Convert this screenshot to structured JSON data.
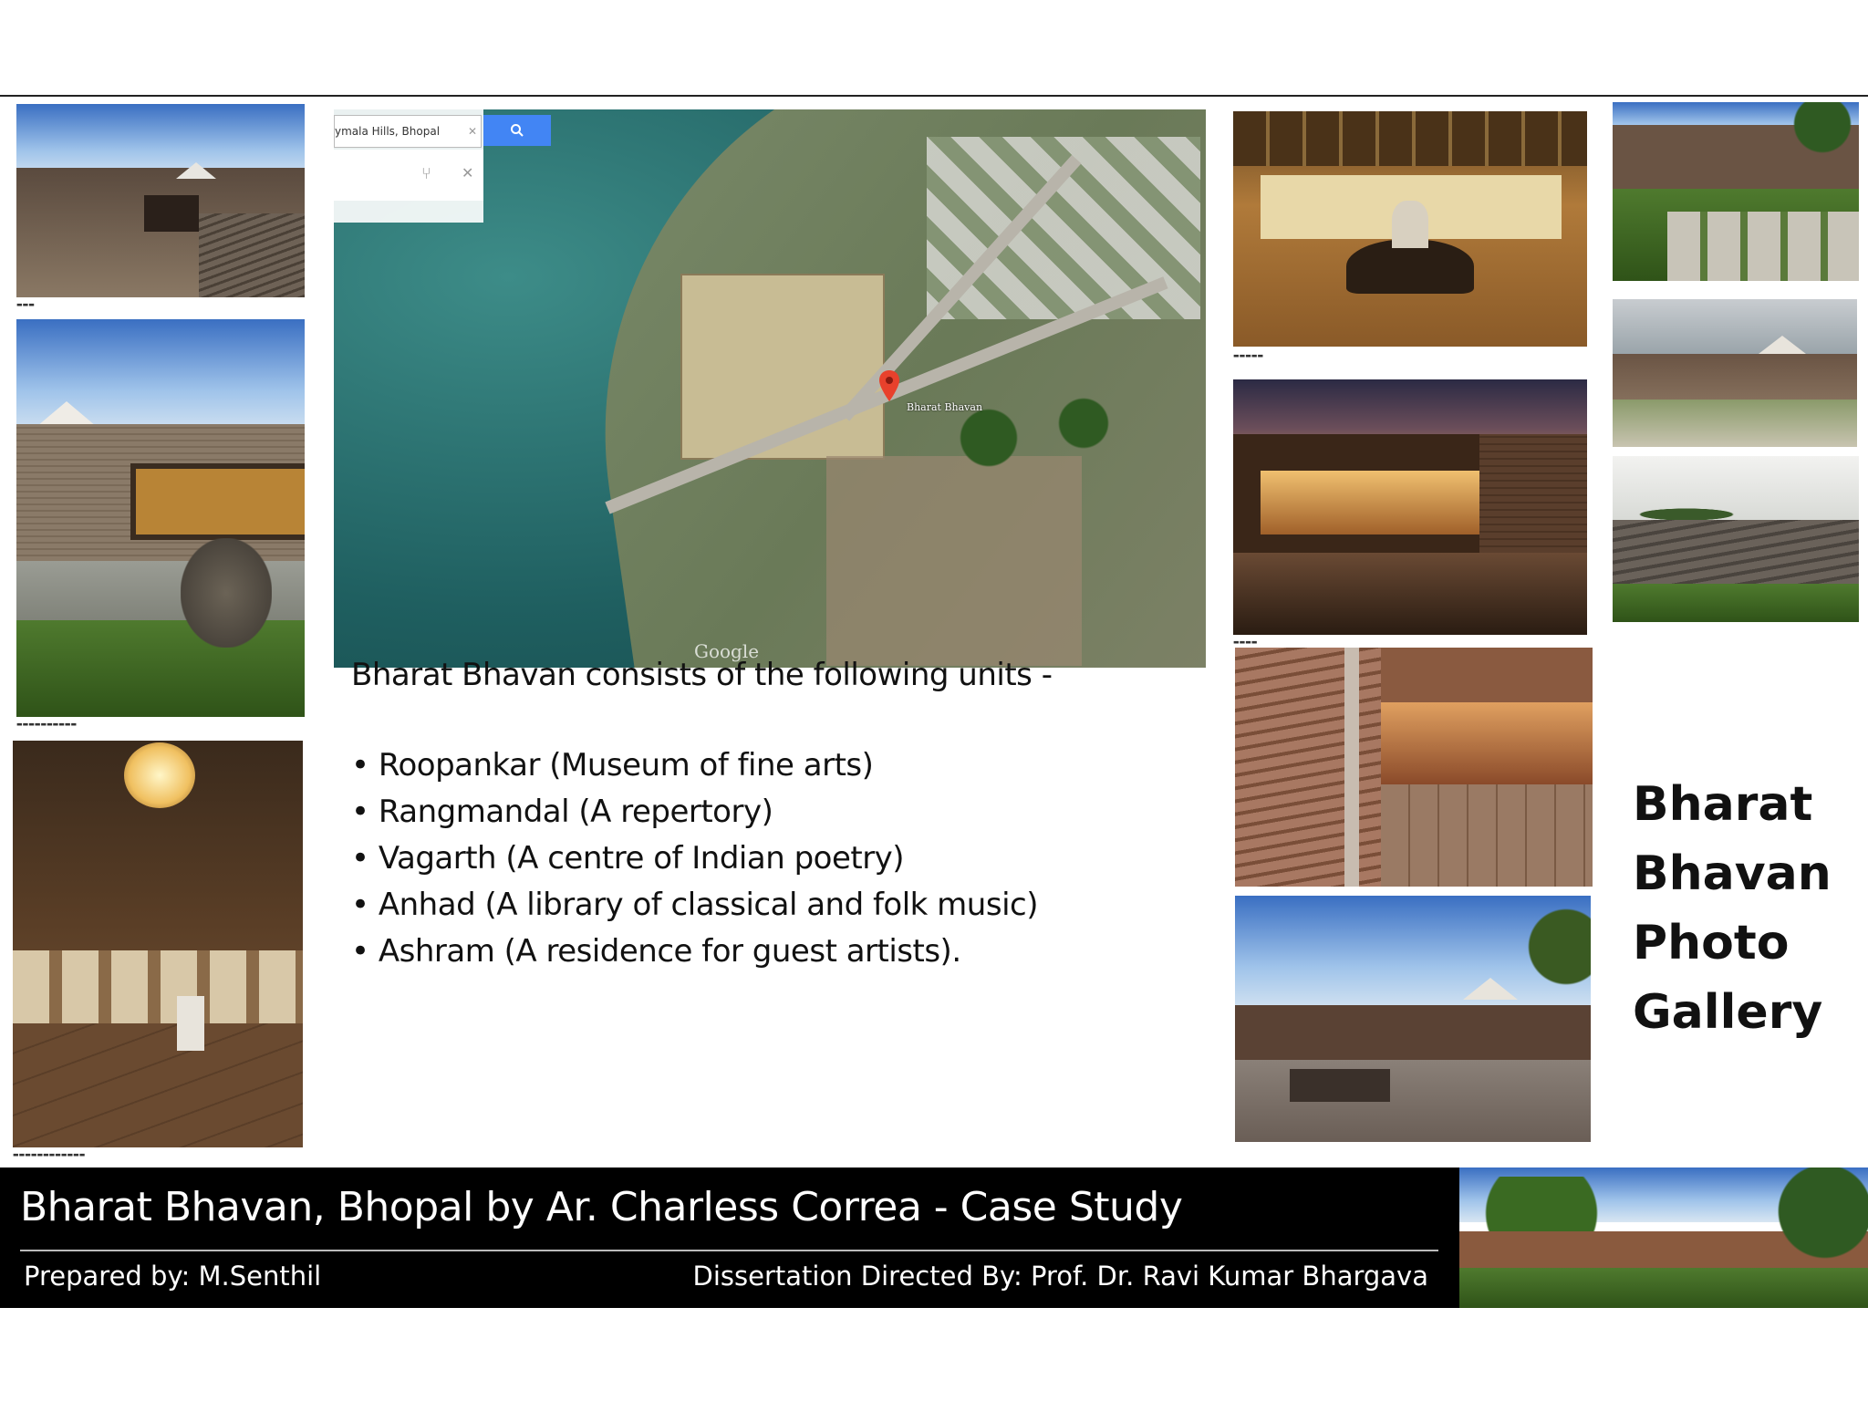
{
  "map": {
    "search_value": "ymala Hills, Bhopal",
    "marker_label": "Bharat Bhavan",
    "watermark": "Google"
  },
  "intro": "Bharat Bhavan consists of the following units -",
  "units": [
    "Roopankar (Museum of fine arts)",
    "Rangmandal (A repertory)",
    "Vagarth (A centre of Indian poetry)",
    "Anhad (A library of classical and folk music)",
    "Ashram (A residence for guest artists)."
  ],
  "gallery_title": [
    "Bharat",
    "Bhavan",
    "Photo",
    "Gallery"
  ],
  "footer": {
    "title": "Bharat Bhavan, Bhopal by  Ar. Charless Correa  - Case Study",
    "prepared": "Prepared by: M.Senthil",
    "directed": "Dissertation Directed By: Prof. Dr. Ravi Kumar Bhargava"
  },
  "icons": {
    "search": "search-icon",
    "clear": "close-icon",
    "directions": "directions-icon",
    "marker": "map-pin-icon"
  }
}
